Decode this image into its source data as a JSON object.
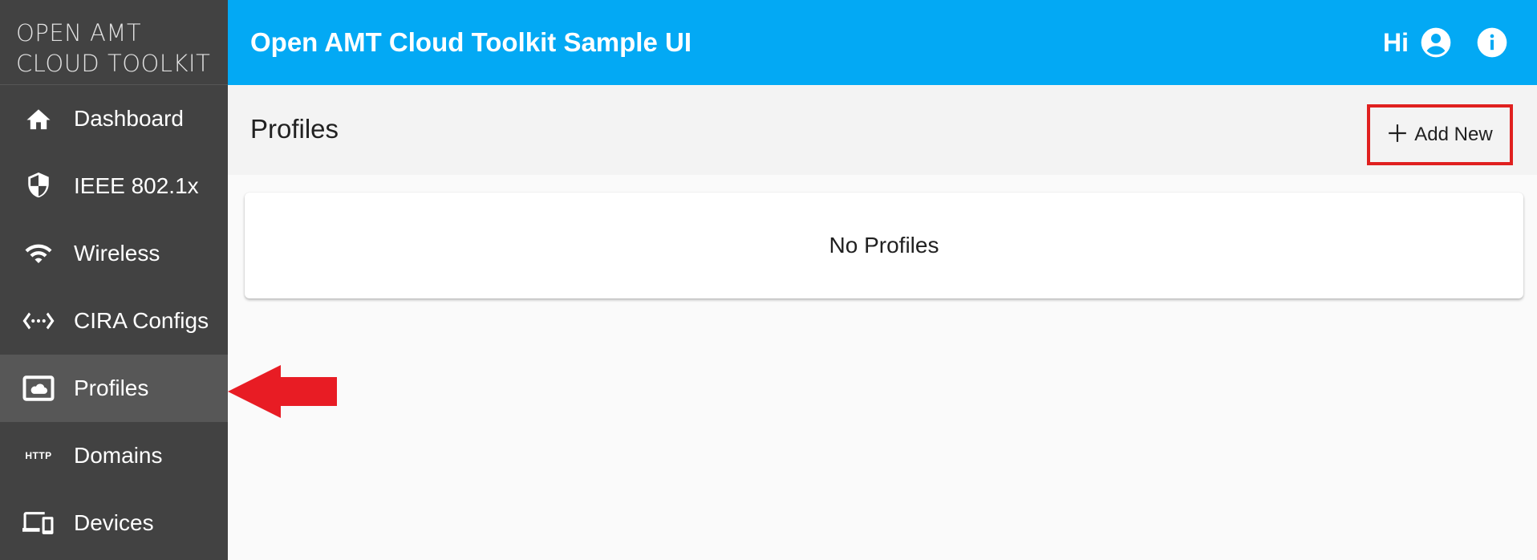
{
  "brand": {
    "line1": "OPEN AMT",
    "line2": "CLOUD TOOLKIT"
  },
  "sidebar": {
    "items": [
      {
        "label": "Dashboard",
        "icon": "home-icon",
        "active": false
      },
      {
        "label": "IEEE 802.1x",
        "icon": "shield-icon",
        "active": false
      },
      {
        "label": "Wireless",
        "icon": "wifi-icon",
        "active": false
      },
      {
        "label": "CIRA Configs",
        "icon": "settings-ethernet-icon",
        "active": false
      },
      {
        "label": "Profiles",
        "icon": "cloud-box-icon",
        "active": true
      },
      {
        "label": "Domains",
        "icon": "http-icon",
        "active": false
      },
      {
        "label": "Devices",
        "icon": "devices-icon",
        "active": false
      }
    ]
  },
  "topbar": {
    "title": "Open AMT Cloud Toolkit Sample UI",
    "greeting": "Hi"
  },
  "page": {
    "title": "Profiles",
    "add_new_label": "Add New",
    "empty_message": "No Profiles"
  },
  "icons": {
    "http_text": "HTTP"
  },
  "colors": {
    "sidebar_bg": "#424242",
    "sidebar_active": "#575757",
    "topbar_bg": "#03a9f4",
    "highlight_red": "#e0201f"
  }
}
